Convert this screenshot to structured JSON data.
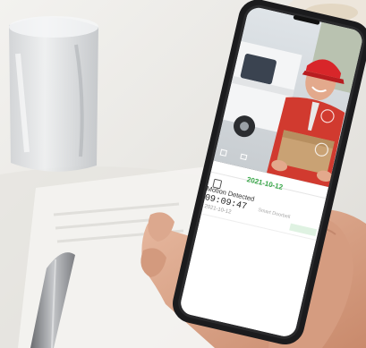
{
  "app": {
    "date": "2021-10-12",
    "event_title": "Motion Detected",
    "event_time": "09:09:47",
    "event_date": "2021-10-12",
    "event_detail": "Smart Doorbell"
  },
  "icons": [
    "pin-icon",
    "mute-icon",
    "calendar-icon",
    "chevron-icon",
    "record-icon",
    "microphone-icon"
  ],
  "colors": {
    "accent_green": "#3aa84a",
    "cap_red": "#d8262a",
    "jacket_red": "#d13a2f",
    "phone_body": "#1b1b1d"
  }
}
